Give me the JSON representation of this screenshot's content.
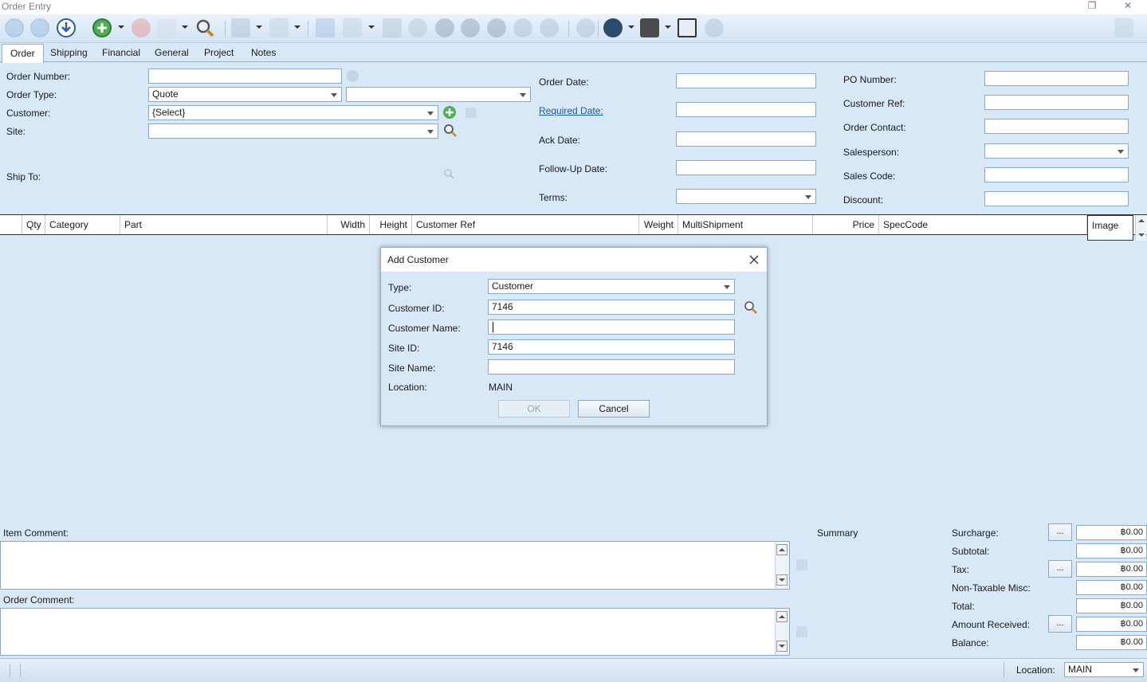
{
  "window": {
    "title": "Order Entry",
    "restore_glyph": "❐",
    "close_glyph": "✕"
  },
  "toolbar": {
    "icons": [
      "back-icon",
      "forward-icon",
      "download-icon",
      "add-icon",
      "delete-icon",
      "copy-icon",
      "search-icon",
      "print-icon",
      "preview-icon",
      "check-icon",
      "email-icon",
      "document-icon",
      "share-icon",
      "user-icon",
      "group-icon",
      "gear-icon",
      "attach-icon",
      "chat-icon",
      "shield-icon",
      "customer-icon",
      "calculator-icon",
      "clock-icon",
      "lock-icon"
    ]
  },
  "tabs": [
    "Order",
    "Shipping",
    "Financial",
    "General",
    "Project",
    "Notes"
  ],
  "form": {
    "order_number_label": "Order Number:",
    "order_type_label": "Order Type:",
    "order_type_value": "Quote",
    "customer_label": "Customer:",
    "customer_value": "{Select}",
    "site_label": "Site:",
    "ship_to_label": "Ship To:",
    "order_date_label": "Order Date:",
    "required_date_label": "Required Date:",
    "ack_date_label": "Ack Date:",
    "followup_date_label": "Follow-Up Date:",
    "terms_label": "Terms:",
    "po_number_label": "PO Number:",
    "customer_ref_label": "Customer Ref:",
    "order_contact_label": "Order Contact:",
    "salesperson_label": "Salesperson:",
    "sales_code_label": "Sales Code:",
    "discount_label": "Discount:"
  },
  "grid": {
    "columns": [
      "Qty",
      "Category",
      "Part",
      "Width",
      "Height",
      "Customer Ref",
      "Weight",
      "MultiShipment",
      "Price",
      "SpecCode",
      "Image"
    ]
  },
  "dialog": {
    "title": "Add Customer",
    "type_label": "Type:",
    "type_value": "Customer",
    "customer_id_label": "Customer ID:",
    "customer_id_value": "7146",
    "customer_name_label": "Customer Name:",
    "customer_name_value": "",
    "site_id_label": "Site ID:",
    "site_id_value": "7146",
    "site_name_label": "Site Name:",
    "site_name_value": "",
    "location_label": "Location:",
    "location_value": "MAIN",
    "ok_label": "OK",
    "cancel_label": "Cancel"
  },
  "comments": {
    "item_comment_label": "Item Comment:",
    "order_comment_label": "Order Comment:"
  },
  "summary": {
    "title": "Summary",
    "dots_label": "...",
    "rows": [
      {
        "label": "Surcharge:",
        "value": "฿0.00"
      },
      {
        "label": "Subtotal:",
        "value": "฿0.00"
      },
      {
        "label": "Tax:",
        "value": "฿0.00"
      },
      {
        "label": "Non-Taxable Misc:",
        "value": "฿0.00"
      },
      {
        "label": "Total:",
        "value": "฿0.00"
      },
      {
        "label": "Amount Received:",
        "value": "฿0.00"
      },
      {
        "label": "Balance:",
        "value": "฿0.00"
      }
    ]
  },
  "status": {
    "location_label": "Location:",
    "location_value": "MAIN"
  }
}
